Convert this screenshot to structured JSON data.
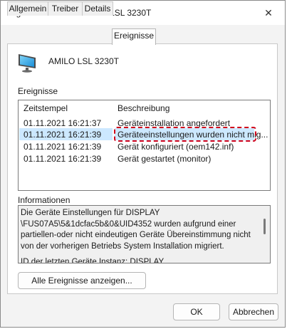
{
  "window": {
    "title": "Eigenschaften von AMILO LSL 3230T",
    "close_glyph": "✕"
  },
  "tabs": [
    {
      "label": "Allgemein"
    },
    {
      "label": "Treiber"
    },
    {
      "label": "Details"
    },
    {
      "label": "Ereignisse",
      "active": true
    }
  ],
  "device": {
    "name": "AMILO LSL 3230T",
    "icon": "monitor-icon"
  },
  "events": {
    "section_label": "Ereignisse",
    "columns": [
      "Zeitstempel",
      "Beschreibung"
    ],
    "rows": [
      {
        "time": "01.11.2021 16:21:37",
        "desc": "Geräteinstallation angefordert"
      },
      {
        "time": "01.11.2021 16:21:39",
        "desc": "Geräteeinstellungen wurden nicht mig...",
        "selected": true
      },
      {
        "time": "01.11.2021 16:21:39",
        "desc": "Gerät konfiguriert (oem142.inf)"
      },
      {
        "time": "01.11.2021 16:21:39",
        "desc": "Gerät gestartet (monitor)"
      }
    ]
  },
  "info": {
    "section_label": "Informationen",
    "paragraph1": "Die Geräte Einstellungen für DISPLAY \\FUS07A5\\5&1dcfac5b&0&UID4352 wurden aufgrund einer partiellen-oder nicht eindeutigen Geräte Übereinstimmung nicht von der vorherigen Betriebs System Installation migriert.",
    "paragraph2": "ID der letzten Geräte Instanz: DISPLAY"
  },
  "buttons": {
    "show_all": "Alle Ereignisse anzeigen...",
    "ok": "OK",
    "cancel": "Abbrechen"
  },
  "colors": {
    "selection": "#cce8ff",
    "focus_ring": "#d0021b"
  }
}
